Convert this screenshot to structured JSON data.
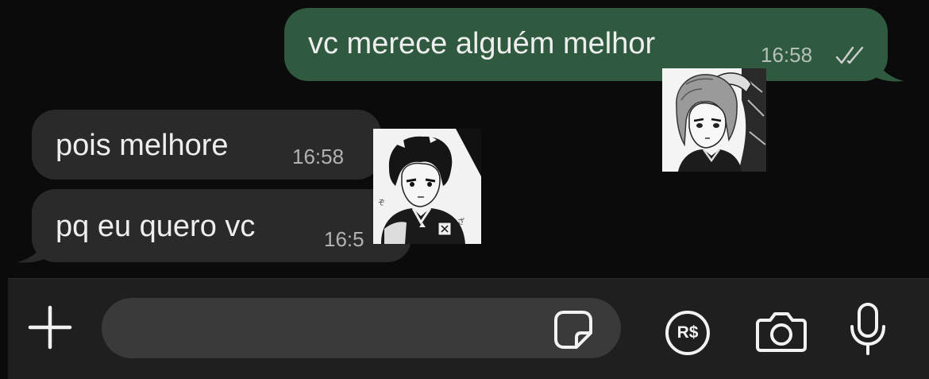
{
  "messages": [
    {
      "direction": "outgoing",
      "text": "vc merece alguém melhor",
      "time": "16:58",
      "status": "read"
    },
    {
      "direction": "incoming",
      "text": "pois melhore",
      "time": "16:58"
    },
    {
      "direction": "incoming",
      "text": "pq eu quero vc",
      "time": "16:5"
    }
  ],
  "stickers": [
    {
      "name": "anime-boy-sticker"
    },
    {
      "name": "anime-girl-sticker"
    }
  ],
  "composer": {
    "placeholder": "",
    "value": "",
    "pay_label": "R$"
  },
  "colors": {
    "background": "#0b0b0b",
    "outgoing_bubble": "#305a3f",
    "incoming_bubble": "#2a2a2a",
    "composer_bar": "#1f1f1f",
    "input_field": "#3a3a3a"
  },
  "icons": [
    "plus-icon",
    "sticker-icon",
    "pix-payment-icon",
    "camera-icon",
    "microphone-icon",
    "double-check-icon"
  ]
}
